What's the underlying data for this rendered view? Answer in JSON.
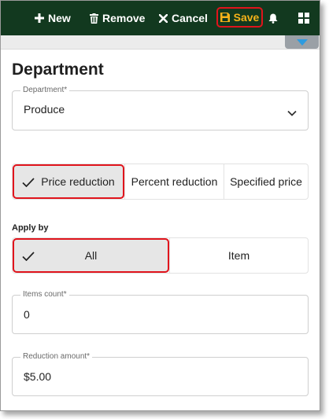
{
  "toolbar": {
    "new_label": "New",
    "remove_label": "Remove",
    "cancel_label": "Cancel",
    "save_label": "Save",
    "bg_color": "#12391f",
    "save_color": "#f5b21a",
    "highlight_color": "#e0141c",
    "icons": [
      "plus-icon",
      "trash-icon",
      "close-icon",
      "save-icon",
      "bell-icon",
      "grid-icon"
    ]
  },
  "page": {
    "title": "Department"
  },
  "department": {
    "label": "Department*",
    "value": "Produce"
  },
  "reduction_type": {
    "options": [
      "Price reduction",
      "Percent reduction",
      "Specified price"
    ],
    "selected": "Price reduction"
  },
  "apply_by": {
    "label": "Apply by",
    "options": [
      "All",
      "Item"
    ],
    "selected": "All"
  },
  "items_count": {
    "label": "Items count*",
    "value": "0"
  },
  "reduction_amount": {
    "label": "Reduction amount*",
    "value": "$5.00"
  }
}
